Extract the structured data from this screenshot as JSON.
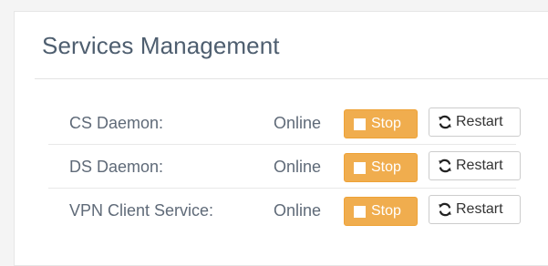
{
  "panel": {
    "title": "Services Management"
  },
  "services": [
    {
      "name": "CS Daemon:",
      "status": "Online",
      "stop_label": "Stop",
      "restart_label": "Restart"
    },
    {
      "name": "DS Daemon:",
      "status": "Online",
      "stop_label": "Stop",
      "restart_label": "Restart"
    },
    {
      "name": "VPN Client Service:",
      "status": "Online",
      "stop_label": "Stop",
      "restart_label": "Restart"
    }
  ],
  "icons": {
    "stop": "stop-icon",
    "restart": "refresh-icon"
  },
  "colors": {
    "stop_button": "#f0ad4e",
    "title_text": "#4e5e6f",
    "label_text": "#5f6a78"
  }
}
